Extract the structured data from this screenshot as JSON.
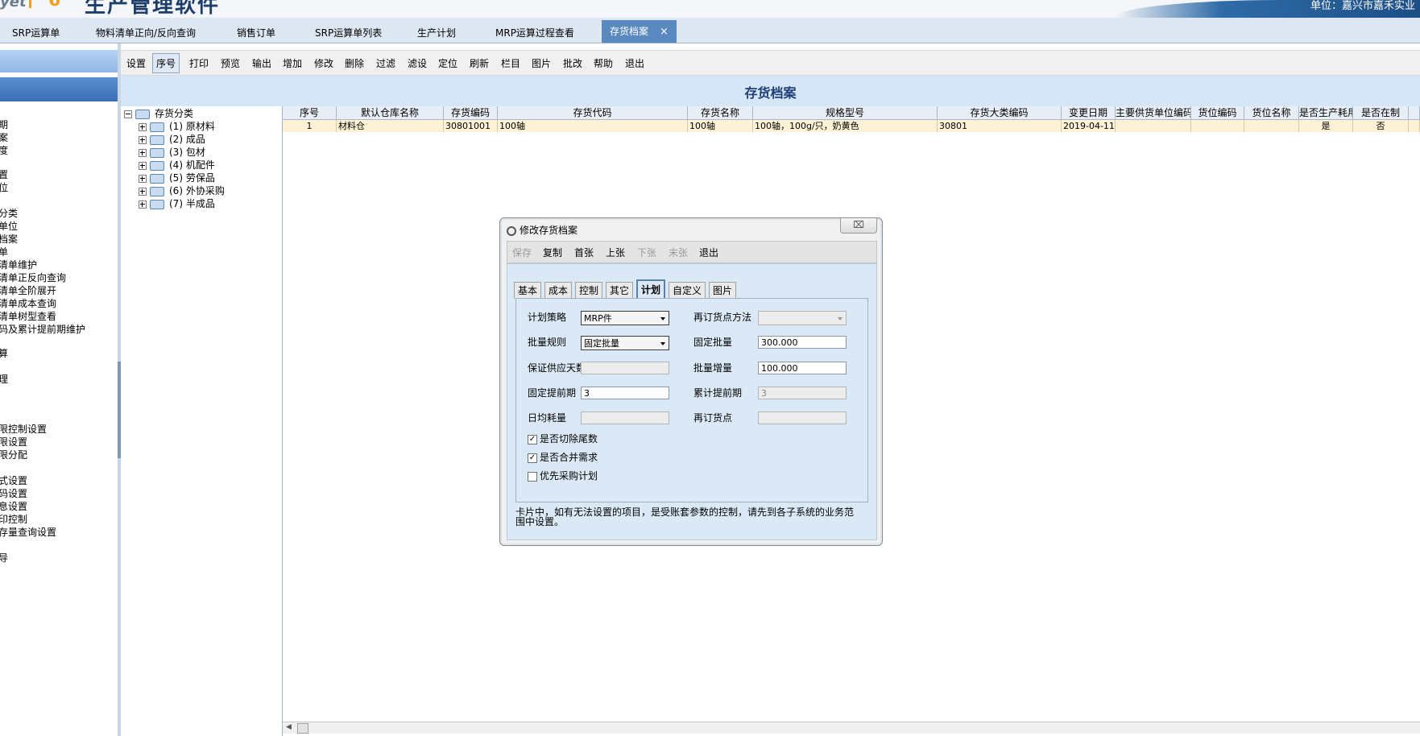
{
  "banner": {
    "logo_left": "yet",
    "logo_mid": "6",
    "logo_title": "生产管理软件",
    "unit": "单位：嘉兴市嘉禾实业"
  },
  "tabs": [
    {
      "label": "SRP运算单"
    },
    {
      "label": "物料清单正向/反向查询"
    },
    {
      "label": "销售订单"
    },
    {
      "label": "SRP运算单列表"
    },
    {
      "label": "生产计划"
    },
    {
      "label": "MRP运算过程查看"
    },
    {
      "label": "存货档案",
      "close": "×"
    }
  ],
  "leftnav": {
    "items": [
      "期",
      "案",
      "度",
      "置",
      "位",
      "分类",
      "单位",
      "档案",
      "单",
      "清单维护",
      "清单正反向查询",
      "清单全阶展开",
      "清单成本查询",
      "清单树型查看",
      "码及累计提前期维护",
      "算",
      "理",
      "限控制设置",
      "限设置",
      "限分配",
      "式设置",
      "码设置",
      "息设置",
      "印控制",
      "存量查询设置",
      "导"
    ]
  },
  "toolbar": {
    "buttons": [
      "设置",
      "序号",
      "打印",
      "预览",
      "输出",
      "增加",
      "修改",
      "删除",
      "过滤",
      "滤设",
      "定位",
      "刷新",
      "栏目",
      "图片",
      "批改",
      "帮助",
      "退出"
    ]
  },
  "page_title": "存货档案",
  "tree": {
    "root": "存货分类",
    "children": [
      "(1) 原材料",
      "(2) 成品",
      "(3) 包材",
      "(4) 机配件",
      "(5) 劳保品",
      "(6) 外协采购",
      "(7) 半成品"
    ]
  },
  "grid": {
    "columns": [
      "序号",
      "默认仓库名称",
      "存货编码",
      "存货代码",
      "存货名称",
      "规格型号",
      "存货大类编码",
      "变更日期",
      "主要供货单位编码",
      "货位编码",
      "货位名称",
      "是否生产耗用",
      "是否在制"
    ],
    "rows": [
      [
        "1",
        "材料仓",
        "30801001",
        "100轴",
        "100轴",
        "100轴，100g/只，奶黄色",
        "30801",
        "2019-04-11",
        "",
        "",
        "",
        "是",
        "否"
      ]
    ]
  },
  "dialog": {
    "title": "修改存货档案",
    "close": "⌧",
    "toolbar": [
      {
        "label": "保存",
        "enabled": false
      },
      {
        "label": "复制",
        "enabled": true
      },
      {
        "label": "首张",
        "enabled": true
      },
      {
        "label": "上张",
        "enabled": true
      },
      {
        "label": "下张",
        "enabled": false
      },
      {
        "label": "末张",
        "enabled": false
      },
      {
        "label": "退出",
        "enabled": true
      }
    ],
    "tabs": [
      "基本",
      "成本",
      "控制",
      "其它",
      "计划",
      "自定义",
      "图片"
    ],
    "active_tab": "计划",
    "fields": {
      "plan_strategy_label": "计划策略",
      "plan_strategy_value": "MRP件",
      "reorder_method_label": "再订货点方法",
      "reorder_method_value": "",
      "lot_rule_label": "批量规则",
      "lot_rule_value": "固定批量",
      "fixed_lot_label": "固定批量",
      "fixed_lot_value": "300.000",
      "supply_days_label": "保证供应天数",
      "supply_days_value": "",
      "lot_increment_label": "批量增量",
      "lot_increment_value": "100.000",
      "fixed_lead_label": "固定提前期",
      "fixed_lead_value": "3",
      "cum_lead_label": "累计提前期",
      "cum_lead_value": "3",
      "daily_usage_label": "日均耗量",
      "daily_usage_value": "",
      "reorder_point_label": "再订货点",
      "reorder_point_value": ""
    },
    "checkboxes": [
      {
        "label": "是否切除尾数",
        "checked": true,
        "mark": "✓"
      },
      {
        "label": "是否合并需求",
        "checked": true,
        "mark": "✓"
      },
      {
        "label": "优先采购计划",
        "checked": false,
        "mark": ""
      }
    ],
    "note": "卡片中，如有无法设置的项目，是受账套参数的控制，请先到各子系统的业务范围中设置。"
  },
  "colors": {
    "active_tab": "#5a89bf",
    "title_band": "#d5e6f7",
    "page_title_text": "#1f3f78",
    "row_highlight": "#fdf2d6",
    "dialog_body": "#dbe9f6"
  }
}
